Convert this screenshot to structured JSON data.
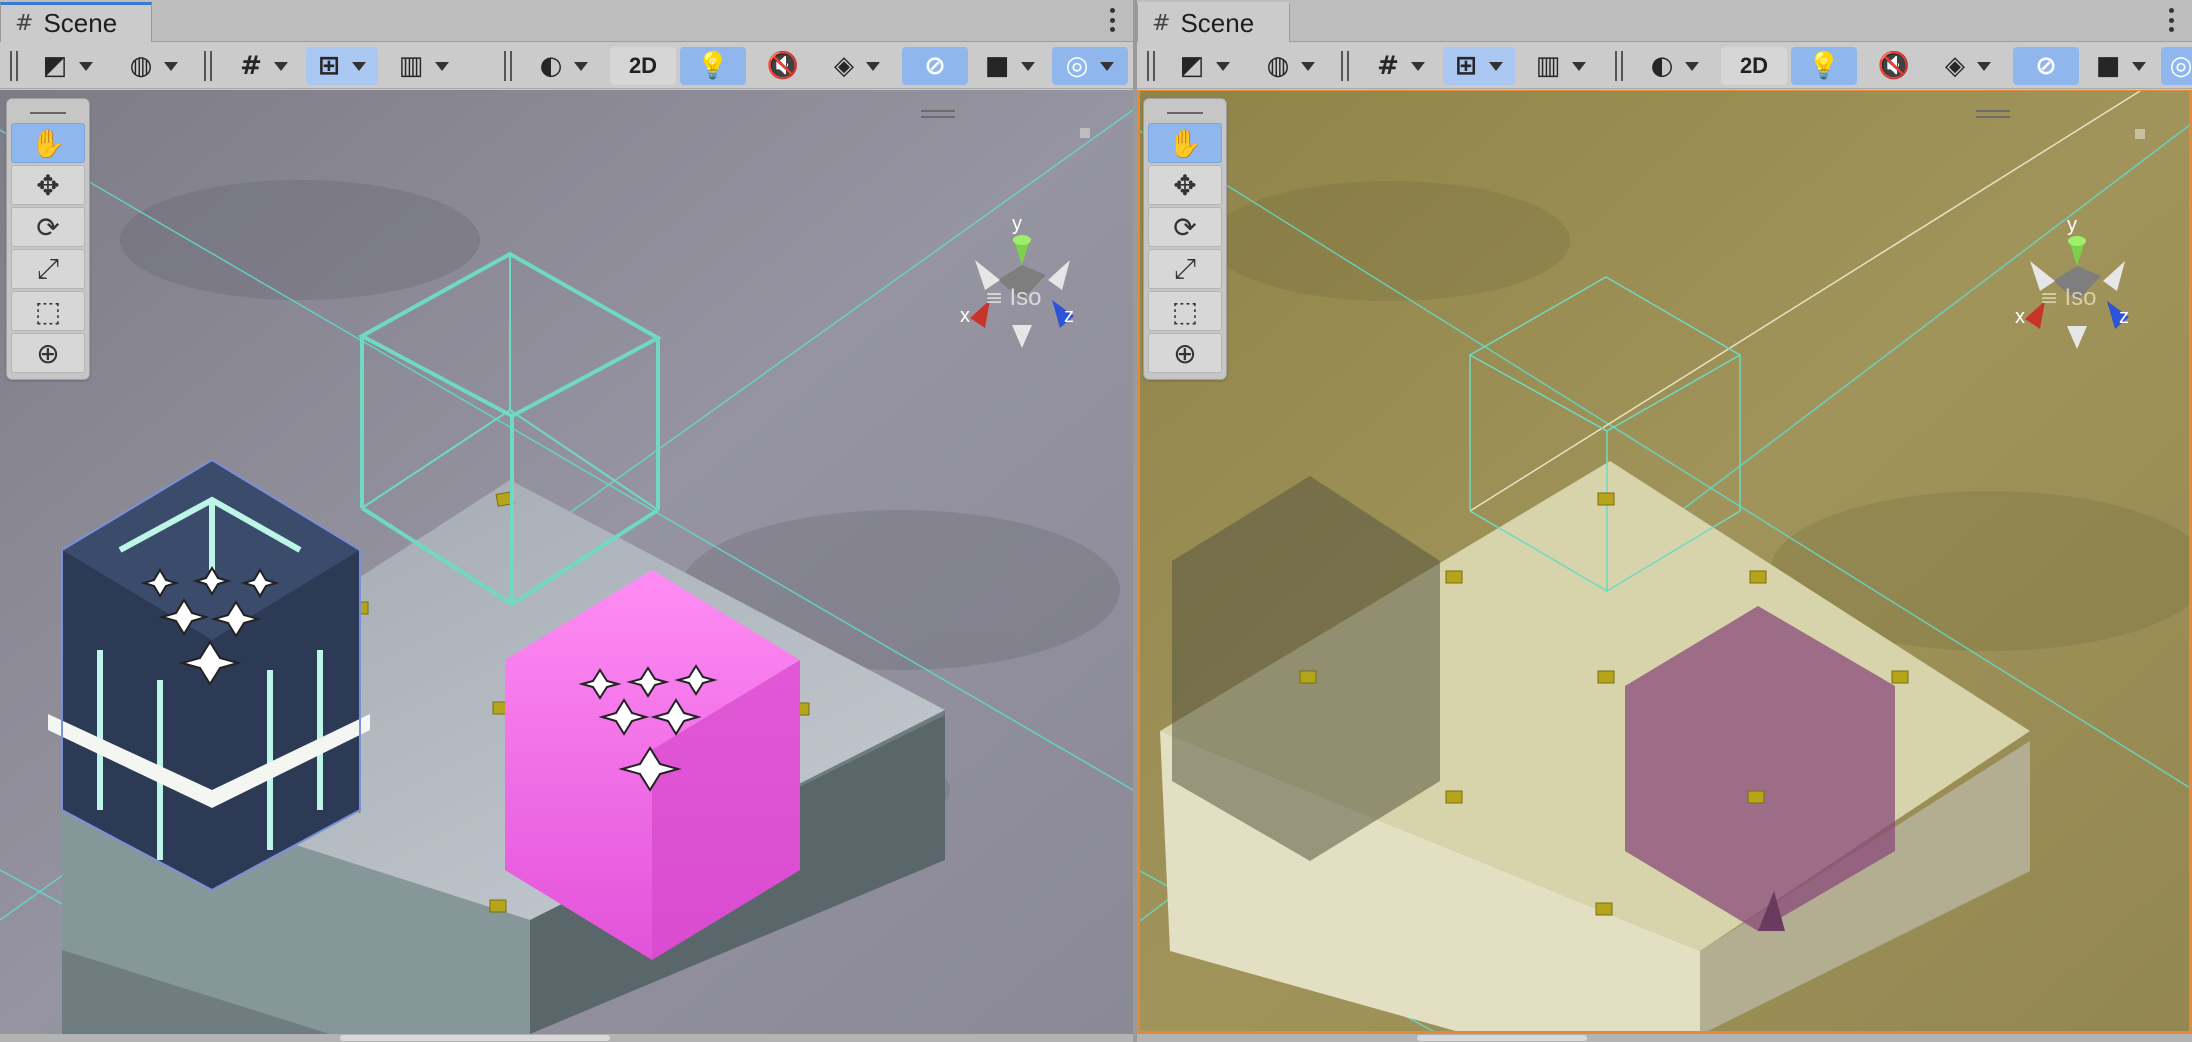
{
  "panes": [
    {
      "tab": {
        "title": "Scene",
        "hash_icon": "#"
      },
      "toolbar": {
        "btn_2d": "2D"
      },
      "gizmo": {
        "y": "y",
        "x": "x",
        "z": "z"
      },
      "projection": "Iso"
    },
    {
      "tab": {
        "title": "Scene",
        "hash_icon": "#"
      },
      "toolbar": {
        "btn_2d": "2D"
      },
      "gizmo": {
        "y": "y",
        "x": "x",
        "z": "z"
      },
      "projection": "Iso"
    }
  ],
  "icons": {
    "hand": "✋",
    "move": "✥",
    "rotate": "⟳",
    "scale": "⤢",
    "rect": "⬚",
    "transform": "⊕",
    "draw_mode": "◩",
    "globe": "◍",
    "grid": "#",
    "snap": "⊞",
    "ruler": "▥",
    "shading": "◐",
    "light": "💡",
    "audio": "🔇",
    "fx": "◈",
    "hidden": "⊘",
    "camera": "■",
    "orbit": "◎"
  },
  "colors": {
    "accent_blue": "#8fb7ee",
    "left_bg": "#8e8d97",
    "right_bg": "#988c4f",
    "cube_magenta": "#f06ce6",
    "wire_cyan": "#6fd9c4",
    "axis_x": "#c8342a",
    "axis_y": "#7bd14a",
    "axis_z": "#2f53d8"
  }
}
